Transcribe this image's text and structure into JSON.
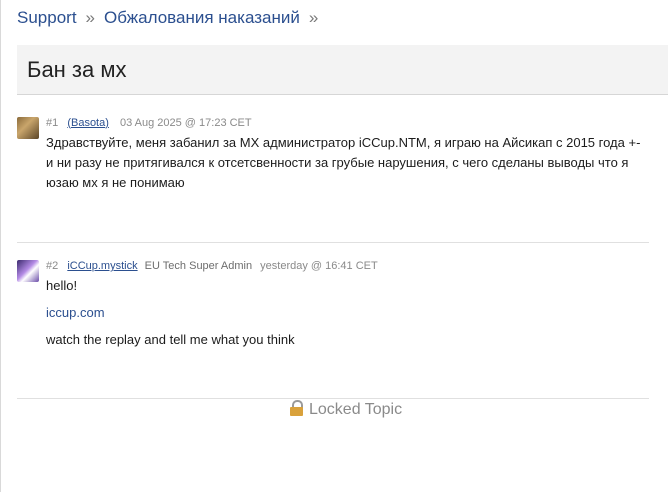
{
  "breadcrumb": {
    "items": [
      "Support",
      "Обжалования наказаний"
    ],
    "separator": "»"
  },
  "topic": {
    "title": "Бан за мх"
  },
  "posts": [
    {
      "number": "#1",
      "username": "Basota",
      "role": "",
      "date": "03 Aug 2025 @ 17:23 CET",
      "avatar_icon": "user-avatar",
      "paragraphs": [
        "Здравствуйте, меня забанил за MX администратор iCCup.NTM, я играю на Айсикап с 2015 года +- и ни разу не притягивался к отсетсвенности за грубые нарушения, с чего сделаны выводы что я юзаю мх я не понимаю"
      ]
    },
    {
      "number": "#2",
      "username": "iCCup.mystick",
      "role": "EU Tech Super Admin",
      "date": "yesterday @ 16:41 CET",
      "avatar_icon": "user-avatar",
      "paragraphs": [
        "hello!",
        "iccup.com",
        "watch the replay and tell me what you think"
      ]
    }
  ],
  "status": {
    "locked_label": "Locked Topic",
    "icon": "lock-icon"
  },
  "colors": {
    "link": "#2b4f8f",
    "muted": "#8a8a8a",
    "titlebar_bg": "#f3f3f3"
  }
}
